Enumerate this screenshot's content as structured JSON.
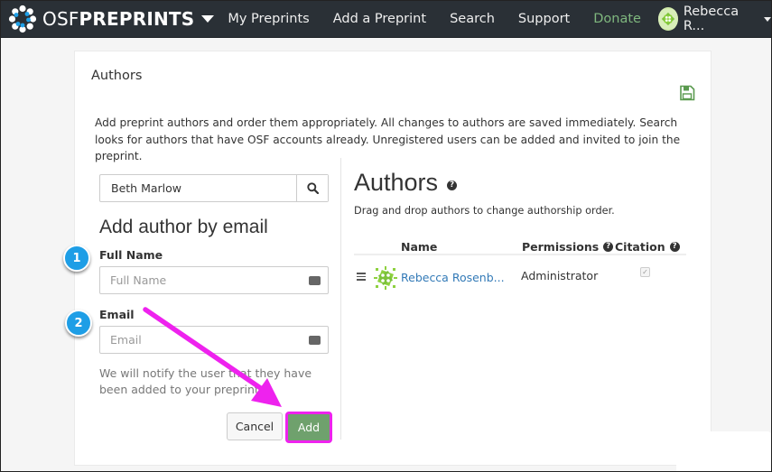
{
  "navbar": {
    "brand_osf": "OSF",
    "brand_preprints": "PREPRINTS",
    "items": [
      {
        "label": "My Preprints"
      },
      {
        "label": "Add a Preprint"
      },
      {
        "label": "Search"
      },
      {
        "label": "Support"
      },
      {
        "label": "Donate"
      }
    ],
    "user_name": "Rebecca R...",
    "colors": {
      "background": "#2a3036",
      "donate": "#7fb77e"
    }
  },
  "panel": {
    "title": "Authors",
    "save_icon": "floppy-disk-icon",
    "intro": "Add preprint authors and order them appropriately. All changes to authors are saved immediately. Search looks for authors that have OSF accounts already. Unregistered users can be added and invited to join the preprint."
  },
  "add_author": {
    "search_value": "Beth Marlow",
    "search_icon": "magnifier-icon",
    "heading": "Add author by email",
    "full_name_label": "Full Name",
    "full_name_placeholder": "Full Name",
    "email_label": "Email",
    "email_placeholder": "Email",
    "notify_text": "We will notify the user that they have been added to your preprint.",
    "cancel_label": "Cancel",
    "add_label": "Add"
  },
  "authors": {
    "heading": "Authors",
    "drag_note": "Drag and drop authors to change authorship order.",
    "columns": {
      "name": "Name",
      "permissions": "Permissions",
      "citation": "Citation"
    },
    "rows": [
      {
        "name": "Rebecca Rosenb...",
        "permission": "Administrator",
        "citation_checked": true
      }
    ]
  },
  "callouts": [
    {
      "number": "1"
    },
    {
      "number": "2"
    }
  ],
  "annotation_color": "#ee22ee",
  "help_glyph": "?",
  "check_glyph": "✓"
}
